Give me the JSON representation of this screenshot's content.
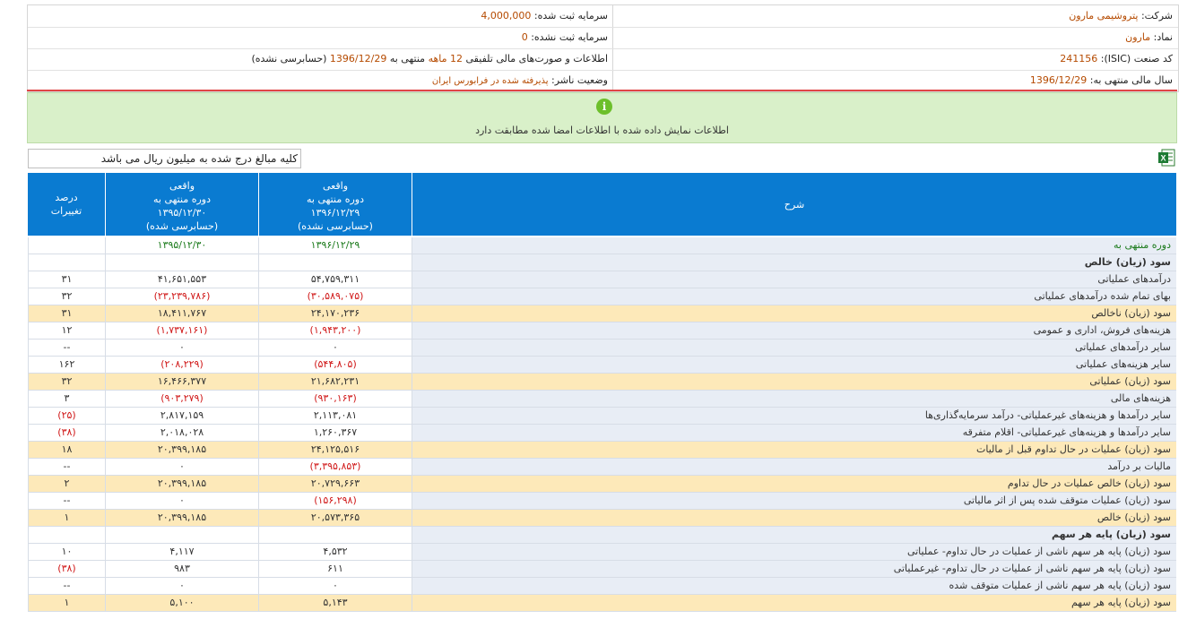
{
  "info": {
    "company_label": "شرکت:",
    "company_value": "پتروشیمی مارون",
    "symbol_label": "نماد:",
    "symbol_value": "مارون",
    "isic_label": "کد صنعت (ISIC):",
    "isic_value": "241156",
    "fiscal_label": "سال مالی منتهی به:",
    "fiscal_value": "1396/12/29",
    "reg_capital_label": "سرمایه ثبت شده:",
    "reg_capital_value": "4,000,000",
    "unreg_capital_label": "سرمایه ثبت نشده:",
    "unreg_capital_value": "0",
    "report_pre": "اطلاعات و صورت‌های مالی تلفیقی",
    "report_period": "12 ماهه",
    "report_mid": "منتهی به",
    "report_date": "1396/12/29",
    "report_post": "(حسابرسی نشده)",
    "publisher_label": "وضعیت ناشر:",
    "publisher_value": "پذیرفته شده در فرابورس ایران"
  },
  "banner": {
    "icon": "info-icon",
    "text": "اطلاعات نمایش داده شده با اطلاعات امضا شده مطابقت دارد"
  },
  "note": "کلیه مبالغ درج شده به میلیون ریال می باشد",
  "excel_icon": "excel-export-icon",
  "colors": {
    "header_blue": "#0a7bd1",
    "highlight": "#fde9b9",
    "row_blue": "#e8edf5",
    "negative": "#d01818",
    "banner_green": "#d9f0c9"
  },
  "table": {
    "headers": {
      "desc": "شرح",
      "col1_l1": "واقعی",
      "col1_l2": "دوره منتهی به",
      "col1_l3": "۱۳۹۶/۱۲/۲۹",
      "col1_l4": "(حسابرسی نشده)",
      "col2_l1": "واقعی",
      "col2_l2": "دوره منتهی به",
      "col2_l3": "۱۳۹۵/۱۲/۳۰",
      "col2_l4": "(حسابرسی شده)",
      "pct_l1": "درصد",
      "pct_l2": "تغییرات"
    },
    "rows": [
      {
        "d": "دوره منتهی به",
        "v1": "۱۳۹۶/۱۲/۲۹",
        "v2": "۱۳۹۵/۱۲/۳۰",
        "p": ""
      },
      {
        "d": "سود (زیان) خالص",
        "v1": "",
        "v2": "",
        "p": ""
      },
      {
        "d": "درآمدهای عملیاتی",
        "v1": "۵۴,۷۵۹,۳۱۱",
        "v2": "۴۱,۶۵۱,۵۵۳",
        "p": "۳۱"
      },
      {
        "d": "بهای تمام شده درآمدهای عملیاتی",
        "v1": "(۳۰,۵۸۹,۰۷۵)",
        "v2": "(۲۳,۲۳۹,۷۸۶)",
        "p": "۳۲"
      },
      {
        "d": "سود (زیان) ناخالص",
        "v1": "۲۴,۱۷۰,۲۳۶",
        "v2": "۱۸,۴۱۱,۷۶۷",
        "p": "۳۱"
      },
      {
        "d": "هزینه‌های فروش، اداری و عمومی",
        "v1": "(۱,۹۴۳,۲۰۰)",
        "v2": "(۱,۷۳۷,۱۶۱)",
        "p": "۱۲"
      },
      {
        "d": "سایر درآمدهای عملیاتی",
        "v1": "۰",
        "v2": "۰",
        "p": "--"
      },
      {
        "d": "سایر هزینه‌های عملیاتی",
        "v1": "(۵۴۴,۸۰۵)",
        "v2": "(۲۰۸,۲۲۹)",
        "p": "۱۶۲"
      },
      {
        "d": "سود (زیان) عملیاتی",
        "v1": "۲۱,۶۸۲,۲۳۱",
        "v2": "۱۶,۴۶۶,۳۷۷",
        "p": "۳۲"
      },
      {
        "d": "هزینه‌های مالی",
        "v1": "(۹۳۰,۱۶۳)",
        "v2": "(۹۰۳,۲۷۹)",
        "p": "۳"
      },
      {
        "d": "سایر درآمدها و هزینه‌های غیرعملیاتی- درآمد سرمایه‌گذاری‌ها",
        "v1": "۲,۱۱۳,۰۸۱",
        "v2": "۲,۸۱۷,۱۵۹",
        "p": "(۲۵)"
      },
      {
        "d": "سایر درآمدها و هزینه‌های غیرعملیاتی- اقلام متفرقه",
        "v1": "۱,۲۶۰,۳۶۷",
        "v2": "۲,۰۱۸,۰۲۸",
        "p": "(۳۸)"
      },
      {
        "d": "سود (زیان) عملیات در حال تداوم قبل از مالیات",
        "v1": "۲۴,۱۲۵,۵۱۶",
        "v2": "۲۰,۳۹۹,۱۸۵",
        "p": "۱۸"
      },
      {
        "d": "مالیات بر درآمد",
        "v1": "(۳,۳۹۵,۸۵۳)",
        "v2": "۰",
        "p": "--"
      },
      {
        "d": "سود (زیان) خالص عملیات در حال تداوم",
        "v1": "۲۰,۷۲۹,۶۶۳",
        "v2": "۲۰,۳۹۹,۱۸۵",
        "p": "۲"
      },
      {
        "d": "سود (زیان) عملیات متوقف شده پس از اثر مالیاتی",
        "v1": "(۱۵۶,۲۹۸)",
        "v2": "۰",
        "p": "--"
      },
      {
        "d": "سود (زیان) خالص",
        "v1": "۲۰,۵۷۳,۳۶۵",
        "v2": "۲۰,۳۹۹,۱۸۵",
        "p": "۱"
      },
      {
        "d": "سود (زیان) پایه هر سهم",
        "v1": "",
        "v2": "",
        "p": ""
      },
      {
        "d": "سود (زیان) پایه هر سهم ناشی از عملیات در حال تداوم- عملیاتی",
        "v1": "۴,۵۳۲",
        "v2": "۴,۱۱۷",
        "p": "۱۰"
      },
      {
        "d": "سود (زیان) پایه هر سهم ناشی از عملیات در حال تداوم- غیرعملیاتی",
        "v1": "۶۱۱",
        "v2": "۹۸۳",
        "p": "(۳۸)"
      },
      {
        "d": "سود (زیان) پایه هر سهم ناشی از عملیات متوقف شده",
        "v1": "۰",
        "v2": "۰",
        "p": "--"
      },
      {
        "d": "سود (زیان) پایه هر سهم",
        "v1": "۵,۱۴۳",
        "v2": "۵,۱۰۰",
        "p": "۱"
      }
    ]
  }
}
